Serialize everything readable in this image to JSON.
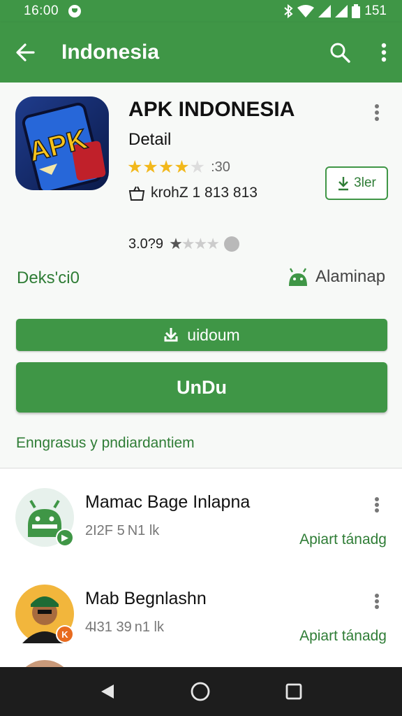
{
  "status_bar": {
    "time": "16:00",
    "battery": "151"
  },
  "app_bar": {
    "title": "Indonesia",
    "back_icon": "arrow-left-icon",
    "search_icon": "search-icon",
    "menu_icon": "more-vert-icon"
  },
  "app": {
    "name": "APK INDONESIA",
    "subtitle": "Detail",
    "icon_text": "APK",
    "rating_count": ":30",
    "meta_text": "krohZ 1 813 813",
    "secondary_button": "3ler",
    "rating2_value": "3.0?9",
    "developer_label": "Deks'ci0",
    "platform_label": "Alaminap",
    "colors": {
      "accent": "#3f9646",
      "star": "#f2b81b"
    }
  },
  "buttons": {
    "small_label": "uidoum",
    "big_label": "UnDu"
  },
  "footer_link": "Enngrasus ​y pndiardantiem",
  "list": [
    {
      "name": "Mamac Bage Inlapna",
      "count": "2I2F 5 N1 lk",
      "action": "Apiart tánadg",
      "badge": "android-badge-icon"
    },
    {
      "name": "Mab Begnlashn",
      "count": "4̴I31 39 n1 lk",
      "action": "Apiart tánadg",
      "badge_text": "K"
    }
  ],
  "nav": {
    "back": "nav-back-icon",
    "home": "nav-home-icon",
    "recents": "nav-recents-icon"
  }
}
